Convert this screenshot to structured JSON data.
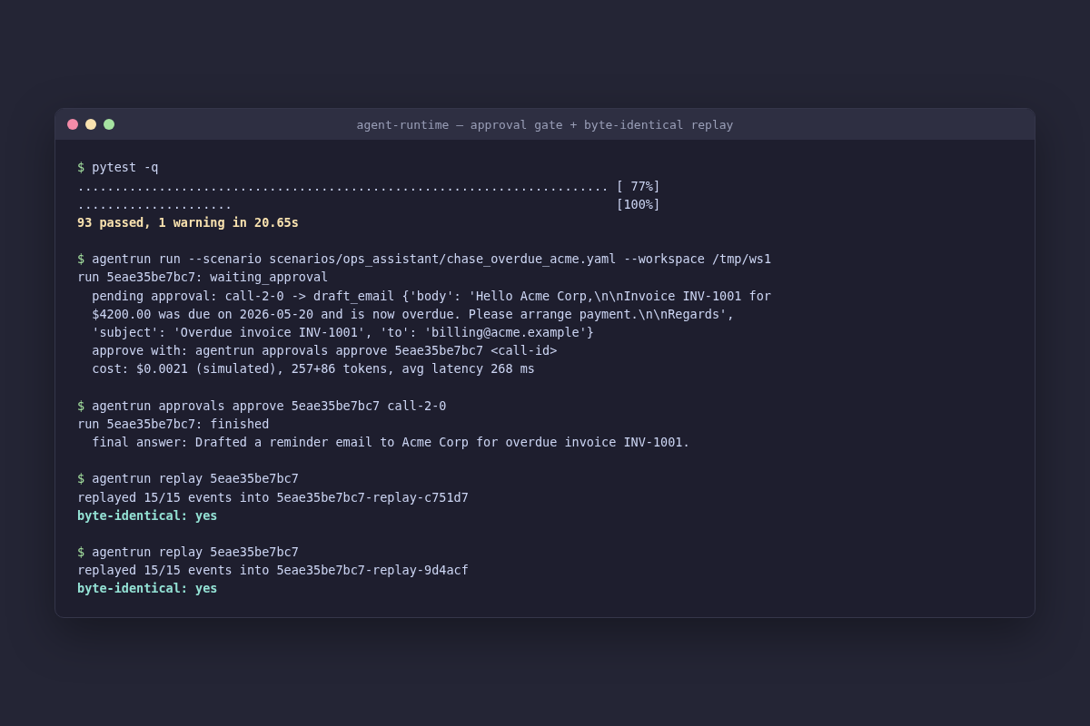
{
  "window": {
    "title": "agent-runtime — approval gate + byte-identical replay"
  },
  "session": [
    {
      "prompt": "$",
      "command": "pytest -q",
      "output": [
        {
          "kind": "progress",
          "dots": "........................................................................",
          "percent": "[ 77%]"
        },
        {
          "kind": "progress",
          "dots": ".....................",
          "percent": "[100%]"
        },
        {
          "kind": "summary",
          "text": "93 passed, 1 warning in 20.65s"
        }
      ]
    },
    {
      "prompt": "$",
      "command": "agentrun run --scenario scenarios/ops_assistant/chase_overdue_acme.yaml --workspace /tmp/ws1",
      "output": [
        {
          "kind": "plain",
          "text": "run 5eae35be7bc7: waiting_approval",
          "children": [
            {
              "kind": "plain",
              "text": "pending approval: call-2-0 -> draft_email {'body': 'Hello Acme Corp,\\n\\nInvoice INV-1001 for"
            },
            {
              "kind": "plain",
              "text": "$4200.00 was due on 2026-05-20 and is now overdue. Please arrange payment.\\n\\nRegards',"
            },
            {
              "kind": "plain",
              "text": "'subject': 'Overdue invoice INV-1001', 'to': 'billing@acme.example'}"
            },
            {
              "kind": "plain",
              "text": "approve with: agentrun approvals approve 5eae35be7bc7 <call-id>"
            },
            {
              "kind": "plain",
              "text": "cost: $0.0021 (simulated), 257+86 tokens, avg latency 268 ms"
            }
          ]
        }
      ]
    },
    {
      "prompt": "$",
      "command": "agentrun approvals approve 5eae35be7bc7 call-2-0",
      "output": [
        {
          "kind": "plain",
          "text": "run 5eae35be7bc7: finished",
          "children": [
            {
              "kind": "plain",
              "text": "final answer: Drafted a reminder email to Acme Corp for overdue invoice INV-1001."
            }
          ]
        }
      ]
    },
    {
      "prompt": "$",
      "command": "agentrun replay 5eae35be7bc7",
      "output": [
        {
          "kind": "plain",
          "text": "replayed 15/15 events into 5eae35be7bc7-replay-c751d7"
        },
        {
          "kind": "status",
          "text": "byte-identical: yes"
        }
      ]
    },
    {
      "prompt": "$",
      "command": "agentrun replay 5eae35be7bc7",
      "output": [
        {
          "kind": "plain",
          "text": "replayed 15/15 events into 5eae35be7bc7-replay-9d4acf"
        },
        {
          "kind": "status",
          "text": "byte-identical: yes"
        }
      ]
    }
  ]
}
